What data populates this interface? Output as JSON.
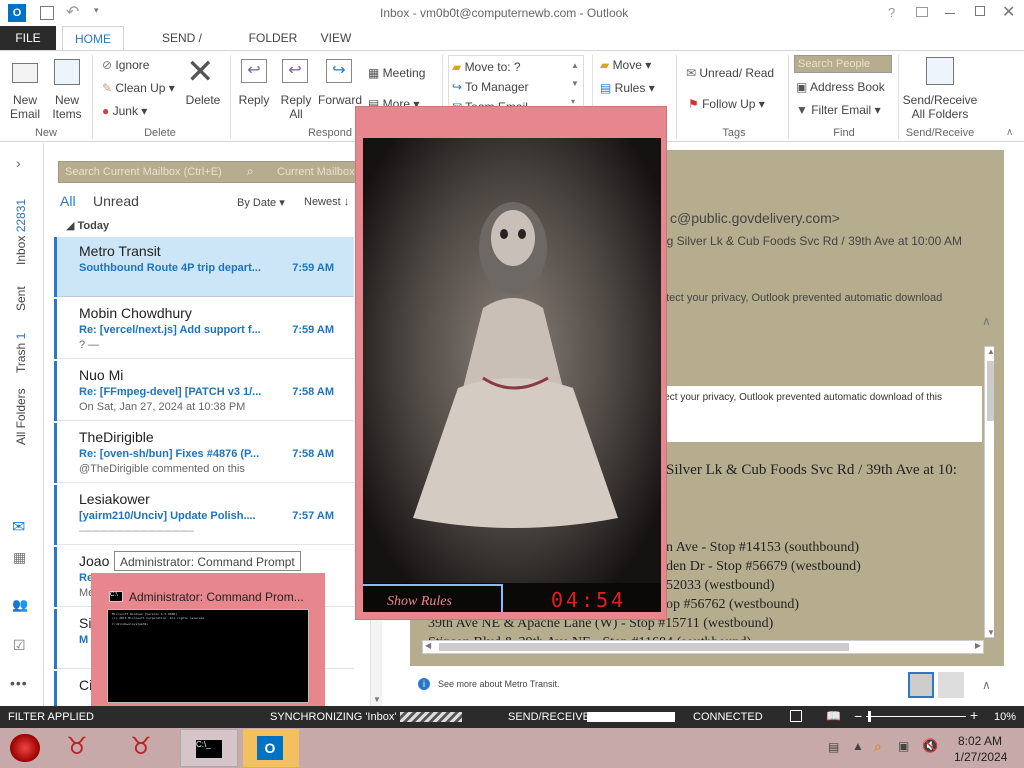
{
  "window": {
    "title": "Inbox - vm0b0t@computernewb.com - Outlook",
    "help": "?"
  },
  "ribbon_tabs": [
    "FILE",
    "HOME",
    "SEND / RECEIVE",
    "FOLDER",
    "VIEW"
  ],
  "ribbon": {
    "new_email": "New\nEmail",
    "new_items": "New\nItems",
    "group_new": "New",
    "ignore": "Ignore",
    "clean_up": "Clean Up",
    "junk": "Junk",
    "delete": "Delete",
    "group_delete": "Delete",
    "reply": "Reply",
    "reply_all": "Reply\nAll",
    "forward": "Forward",
    "meeting": "Meeting",
    "more": "More",
    "group_respond": "Respond",
    "move_to": "Move to: ?",
    "to_manager": "To Manager",
    "team_email": "Team Email",
    "move": "Move",
    "rules": "Rules",
    "unread_read": "Unread/ Read",
    "follow_up": "Follow Up",
    "group_tags": "Tags",
    "search_people": "Search People",
    "address_book": "Address Book",
    "filter_email": "Filter Email",
    "group_find": "Find",
    "send_receive_all": "Send/Receive\nAll Folders",
    "group_send_receive": "Send/Receive"
  },
  "leftnav": {
    "inbox": "Inbox",
    "inbox_count": "22831",
    "sent": "Sent",
    "trash": "Trash",
    "trash_count": "1",
    "all_folders": "All Folders"
  },
  "search": {
    "placeholder": "Search Current Mailbox (Ctrl+E)",
    "scope": "Current Mailbox"
  },
  "filters": {
    "all": "All",
    "unread": "Unread",
    "by_date": "By Date",
    "newest": "Newest"
  },
  "group_today": "Today",
  "messages": [
    {
      "from": "Metro Transit",
      "subject": "Southbound Route 4P trip depart...",
      "time": "7:59 AM",
      "preview": ""
    },
    {
      "from": "Mobin Chowdhury",
      "subject": "Re: [vercel/next.js] Add support f...",
      "time": "7:59 AM",
      "preview": "? —"
    },
    {
      "from": "Nuo Mi",
      "subject": "Re: [FFmpeg-devel] [PATCH v3 1/...",
      "time": "7:58 AM",
      "preview": "On Sat, Jan 27, 2024 at 10:38 PM"
    },
    {
      "from": "TheDirigible",
      "subject": "Re: [oven-sh/bun] Fixes #4876 (P...",
      "time": "7:58 AM",
      "preview": "@TheDirigible commented on this"
    },
    {
      "from": "Lesiakower",
      "subject": "[yairm210/Unciv] Update Polish....",
      "time": "7:57 AM",
      "preview": "——————————————"
    },
    {
      "from": "Joao",
      "subject": "Re",
      "time": "",
      "preview": "Me"
    },
    {
      "from": "Si",
      "subject": "M",
      "time": "",
      "preview": ""
    },
    {
      "from": "Ci",
      "subject": "",
      "time": "",
      "preview": ""
    }
  ],
  "tooltip": "Administrator: Command Prompt",
  "cmd": {
    "title": "Administrator: Command Prom...",
    "line1": "Microsoft Windows [Version 6.3.9600]",
    "line2": "(c) 2013 Microsoft Corporation. All rights reserved.",
    "line3": "C:\\Windows\\system32>"
  },
  "reading": {
    "from_partial": "c@public.govdelivery.com>",
    "subject_partial": "ng Silver Lk & Cub Foods Svc Rd / 39th Ave at 10:00 AM",
    "privacy_partial": "otect your privacy, Outlook prevented automatic download",
    "privacy_inner": "protect your privacy, Outlook prevented automatic download of this",
    "body_head": "Silver Lk & Cub Foods Svc Rd / 39th Ave at 10:",
    "stops": [
      "n Ave - Stop #14153 (southbound)",
      "den Dr - Stop #56679 (westbound)",
      "52033 (westbound)",
      "op #56762 (westbound)",
      "39th Ave NE & Apache Lane (W) - Stop #15711 (westbound)",
      "Stinson Blvd & 39th Ave NE - Stop #11684 (southbound)"
    ],
    "see_more": "See more about Metro Transit."
  },
  "video": {
    "caption": "Show Rules",
    "timer": "04:54"
  },
  "status": {
    "filter": "FILTER APPLIED",
    "sync": "SYNCHRONIZING 'Inbox'",
    "send_receive": "SEND/RECEIVE",
    "connected": "CONNECTED",
    "zoom": "10%"
  },
  "taskbar": {
    "time": "8:02 AM",
    "date": "1/27/2024"
  },
  "colors": {
    "accent": "#2b78c5",
    "file_tab": "#2b2b2b",
    "popup": "#e8868e",
    "timer": "#e02020"
  }
}
